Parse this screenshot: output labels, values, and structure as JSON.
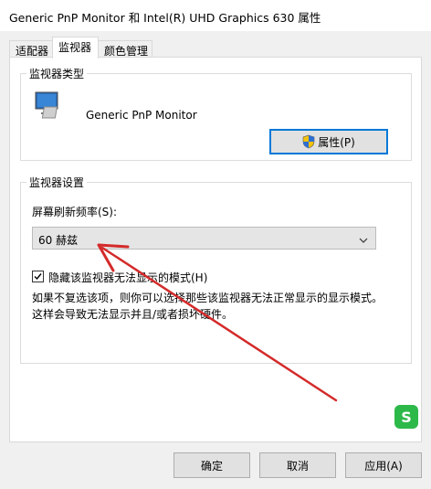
{
  "window": {
    "title": "Generic PnP Monitor 和 Intel(R) UHD Graphics 630 属性"
  },
  "tabs": [
    {
      "label": "适配器",
      "active": false
    },
    {
      "label": "监视器",
      "active": true
    },
    {
      "label": "颜色管理",
      "active": false
    }
  ],
  "monitor_type": {
    "group_label": "监视器类型",
    "monitor_name": "Generic PnP Monitor",
    "properties_button": "属性(P)",
    "icon": "monitor-icon"
  },
  "monitor_settings": {
    "group_label": "监视器设置",
    "refresh_label": "屏幕刷新频率(S):",
    "refresh_value": "60 赫兹",
    "hide_modes_checked": true,
    "hide_modes_label": "隐藏该监视器无法显示的模式(H)",
    "description_line1": "如果不复选该项，则你可以选择那些该监视器无法正常显示的显示模式。",
    "description_line2": "这样会导致无法显示并且/或者损坏硬件。"
  },
  "footer": {
    "ok": "确定",
    "cancel": "取消",
    "apply": "应用(A)"
  },
  "colors": {
    "arrow": "#d42a2a",
    "focus": "#0078d7"
  }
}
